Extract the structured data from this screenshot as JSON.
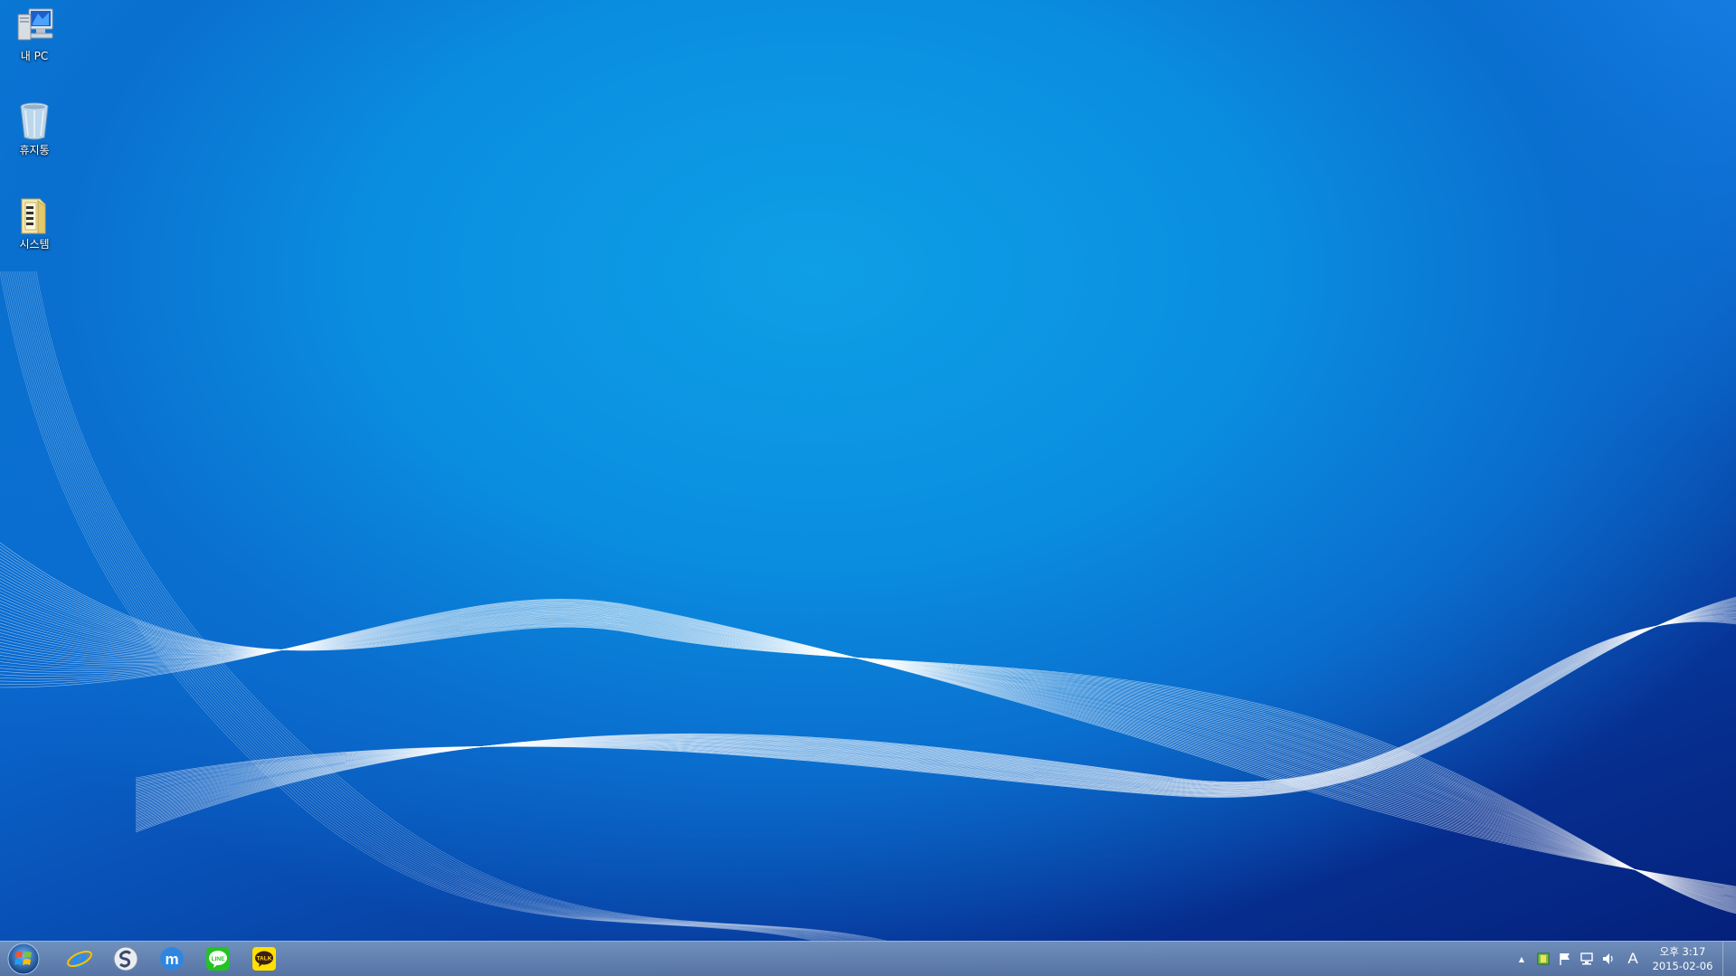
{
  "desktop": {
    "icons": [
      {
        "label": "내 PC",
        "icon": "computer-icon"
      },
      {
        "label": "휴지통",
        "icon": "recycle-bin-icon"
      },
      {
        "label": "시스템",
        "icon": "folder-icon"
      }
    ]
  },
  "taskbar": {
    "start": {
      "icon": "windows-start-icon"
    },
    "pinned_apps": [
      {
        "icon": "internet-explorer-icon"
      },
      {
        "icon": "s-app-icon"
      },
      {
        "icon": "m-app-icon"
      },
      {
        "icon": "line-messenger-icon",
        "text": "LINE"
      },
      {
        "icon": "kakaotalk-icon",
        "text": "TALK"
      }
    ],
    "tray": {
      "chevron_glyph": "▲",
      "ime_glyph": "A",
      "clock_time": "오후 3:17",
      "clock_date": "2015-02-06"
    }
  },
  "colors": {
    "line_green": "#21c421",
    "kakao_yellow": "#ffe000",
    "ie_blue": "#1e90ff",
    "taskbar": "#6f8db8"
  }
}
